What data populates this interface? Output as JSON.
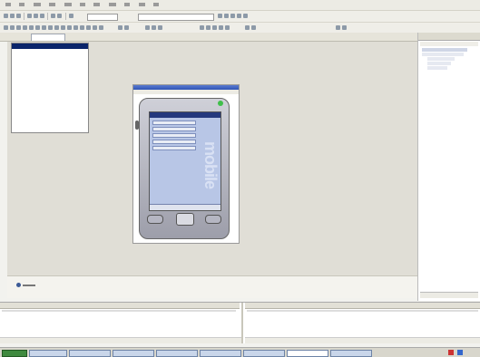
{
  "toolbox": {
    "title": ""
  },
  "device_window": {
    "title": "",
    "menu": ""
  },
  "device_screen": {
    "brand_text": "mobile"
  },
  "right_panel": {
    "title": ""
  },
  "status": {
    "text": ""
  }
}
